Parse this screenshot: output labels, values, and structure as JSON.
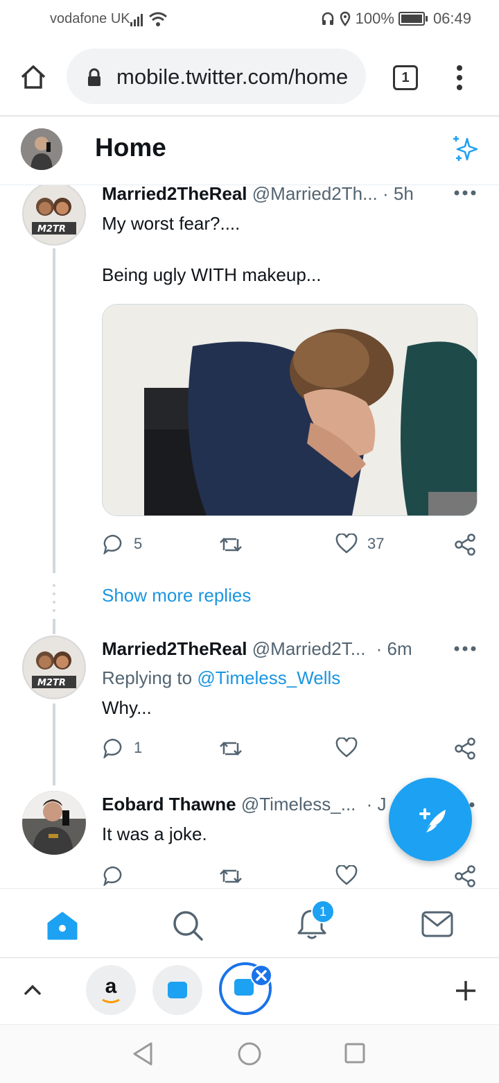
{
  "status_bar": {
    "carrier": "vodafone UK",
    "battery": "100%",
    "time": "06:49"
  },
  "browser": {
    "url": "mobile.twitter.com/home",
    "tab_count": "1"
  },
  "header": {
    "title": "Home"
  },
  "tweets": [
    {
      "name": "Married2TheReal",
      "handle": "@Married2Th...",
      "time": "· 5h",
      "text_line1": "My worst fear?....",
      "text_line2": "Being ugly WITH makeup...",
      "replies": "5",
      "likes": "37"
    },
    {
      "name": "Married2TheReal",
      "handle": "@Married2T...",
      "time": "· 6m",
      "replying_prefix": "Replying to",
      "replying_to": "@Timeless_Wells",
      "text": "Why...",
      "replies": "1"
    },
    {
      "name": "Eobard Thawne",
      "handle": "@Timeless_...",
      "time": "· J",
      "text": "It was a joke."
    }
  ],
  "thread": {
    "show_more": "Show more replies"
  },
  "bottom_nav": {
    "notifications_badge": "1"
  },
  "bottom_browser": {
    "amazon_label": "a"
  },
  "colors": {
    "twitter_blue": "#1da1f2",
    "link_blue": "#1b95e0"
  }
}
